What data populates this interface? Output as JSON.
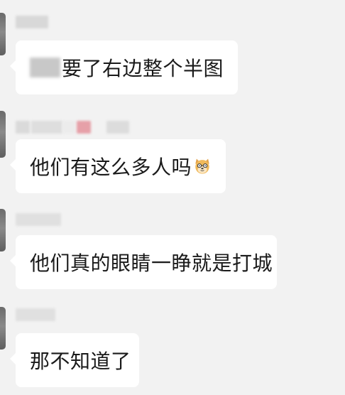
{
  "messages": [
    {
      "prefix": "",
      "text": "要了右边整个半图",
      "has_emoji": false
    },
    {
      "text": "他们有这么多人吗",
      "has_emoji": true,
      "emoji_name": "doge-face-icon"
    },
    {
      "text": "他们真的眼睛一睁就是打城",
      "has_emoji": false
    },
    {
      "text": "那不知道了",
      "has_emoji": false
    }
  ],
  "colors": {
    "background": "#f2f2f2",
    "bubble": "#ffffff",
    "text": "#1a1a1a",
    "blur_pink": "#e6a0a8"
  }
}
